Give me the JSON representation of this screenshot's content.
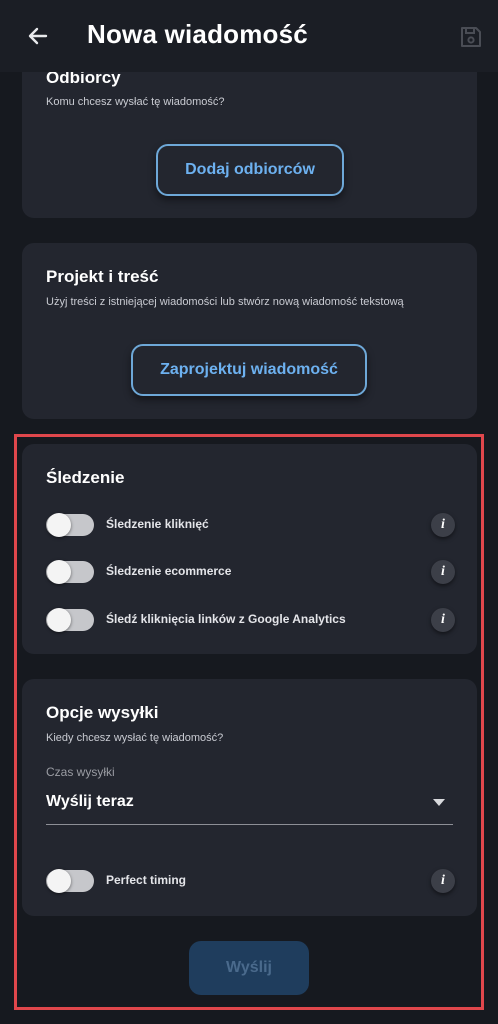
{
  "header": {
    "back_icon": "arrow-left-icon",
    "title": "Nowa wiadomość",
    "save_icon": "floppy-disk-icon"
  },
  "recipients": {
    "title": "Odbiorcy",
    "subtitle": "Komu chcesz wysłać tę wiadomość?",
    "button_label": "Dodaj odbiorców"
  },
  "design": {
    "title": "Projekt i treść",
    "subtitle": "Użyj treści z istniejącej wiadomości lub stwórz nową wiadomość tekstową",
    "button_label": "Zaprojektuj wiadomość"
  },
  "tracking": {
    "title": "Śledzenie",
    "toggles": [
      {
        "label": "Śledzenie kliknięć",
        "on": false,
        "info_icon": "info-icon"
      },
      {
        "label": "Śledzenie ecommerce",
        "on": false,
        "info_icon": "info-icon"
      },
      {
        "label": "Śledź kliknięcia linków z Google Analytics",
        "on": false,
        "info_icon": "info-icon"
      }
    ]
  },
  "send_options": {
    "title": "Opcje wysyłki",
    "subtitle": "Kiedy chcesz wysłać tę wiadomość?",
    "send_time_label": "Czas wysyłki",
    "send_time_value": "Wyślij teraz",
    "perfect_timing_label": "Perfect timing",
    "perfect_timing_on": false
  },
  "send_button": {
    "label": "Wyślij",
    "enabled": false
  },
  "colors": {
    "background": "#16191f",
    "card": "#23262f",
    "accent": "#6db1f0",
    "highlight": "#e0474c"
  }
}
